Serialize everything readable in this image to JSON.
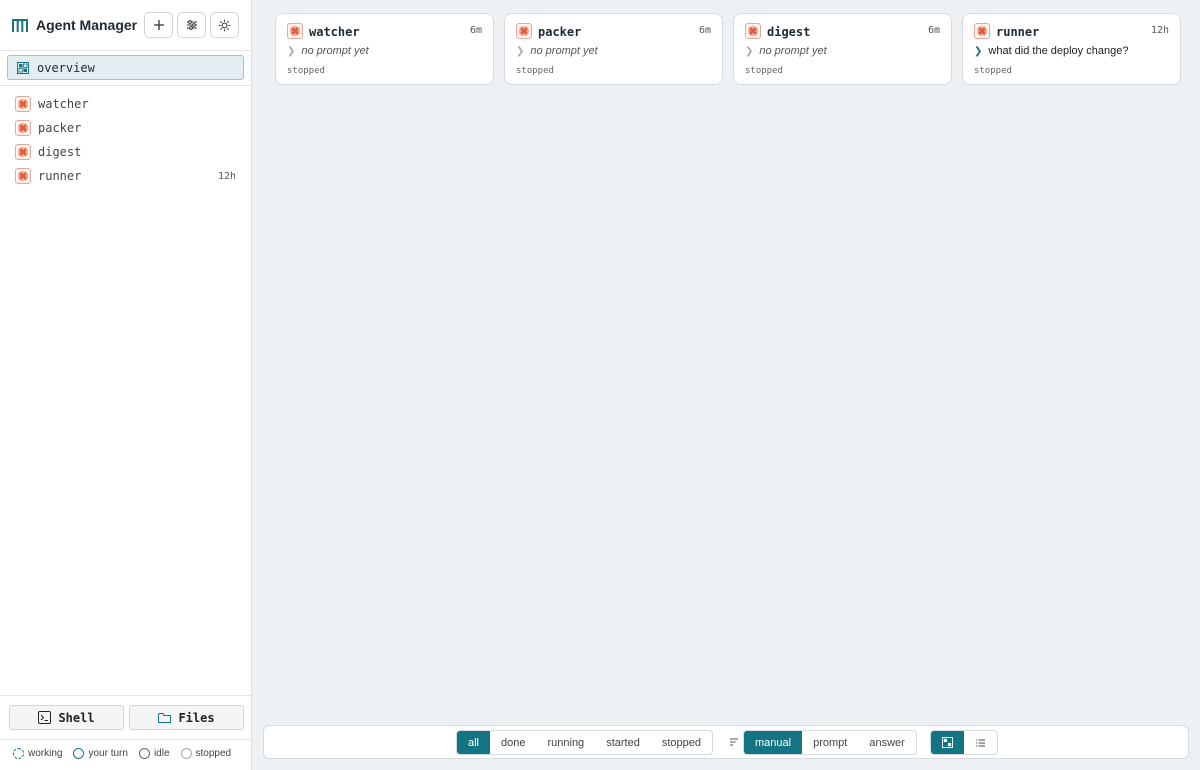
{
  "app": {
    "title": "Agent Manager"
  },
  "header_buttons": [
    {
      "icon": "plus-icon"
    },
    {
      "icon": "sliders-icon"
    },
    {
      "icon": "sun-icon"
    }
  ],
  "overview": {
    "label": "overview"
  },
  "agents": [
    {
      "name": "watcher",
      "age": ""
    },
    {
      "name": "packer",
      "age": ""
    },
    {
      "name": "digest",
      "age": ""
    },
    {
      "name": "runner",
      "age": "12h"
    }
  ],
  "footer": {
    "shell_label": "Shell",
    "files_label": "Files"
  },
  "legend": [
    {
      "label": "working"
    },
    {
      "label": "your turn"
    },
    {
      "label": "idle"
    },
    {
      "label": "stopped"
    }
  ],
  "cards": [
    {
      "name": "watcher",
      "age": "6m",
      "prompt": "no prompt yet",
      "status": "stopped"
    },
    {
      "name": "packer",
      "age": "6m",
      "prompt": "no prompt yet",
      "status": "stopped"
    },
    {
      "name": "digest",
      "age": "6m",
      "prompt": "no prompt yet",
      "status": "stopped"
    },
    {
      "name": "runner",
      "age": "12h",
      "prompt": "what did the deploy change?",
      "status": "stopped"
    }
  ],
  "toolbar": {
    "filters": [
      "all",
      "done",
      "running",
      "started",
      "stopped"
    ],
    "filter_selected": "all",
    "sorts": [
      "manual",
      "prompt",
      "answer"
    ],
    "sort_selected": "manual",
    "view_selected": "grid"
  },
  "colors": {
    "accent": "#137584",
    "agent_icon": "#e0593a",
    "background": "#edf1f4"
  }
}
